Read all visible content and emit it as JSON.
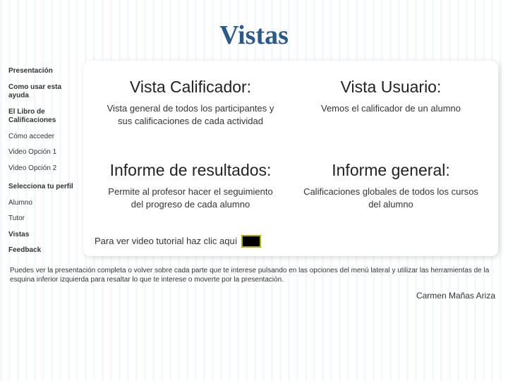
{
  "title": "Vistas",
  "sidebar": {
    "items": [
      {
        "label": "Presentación",
        "bold": true
      },
      {
        "label": "Como usar esta ayuda",
        "bold": true
      },
      {
        "label": "El Libro de Calificaciones",
        "bold": true
      },
      {
        "label": "Cómo acceder",
        "bold": false
      },
      {
        "label": "Video Opción 1",
        "bold": false
      },
      {
        "label": "Video Opción 2",
        "bold": false
      },
      {
        "label": "Selecciona tu perfil",
        "bold": true
      },
      {
        "label": "Alumno",
        "bold": false
      },
      {
        "label": "Tutor",
        "bold": false
      },
      {
        "label": "Vistas",
        "bold": true
      },
      {
        "label": "Feedback",
        "bold": true
      }
    ]
  },
  "views": {
    "calificador": {
      "title": "Vista Calificador:",
      "desc": "Vista general de todos los participantes y sus calificaciones de cada actividad"
    },
    "usuario": {
      "title": "Vista Usuario:",
      "desc": "Vemos el calificador de un alumno"
    },
    "resultados": {
      "title": "Informe de resultados:",
      "desc": "Permite al profesor hacer el seguimiento del progreso de cada alumno"
    },
    "general": {
      "title": "Informe general:",
      "desc": "Calificaciones globales de todos los cursos del alumno"
    }
  },
  "video_hint": "Para ver video tutorial haz clic aquí",
  "footer": "Puedes ver la presentación completa o volver sobre cada parte que te interese pulsando en las opciones del menú lateral y utilizar las herramientas de la esquina inferior izquierda para resaltar lo que te interese o moverte por la presentación.",
  "author": "Carmen Mañas Ariza"
}
